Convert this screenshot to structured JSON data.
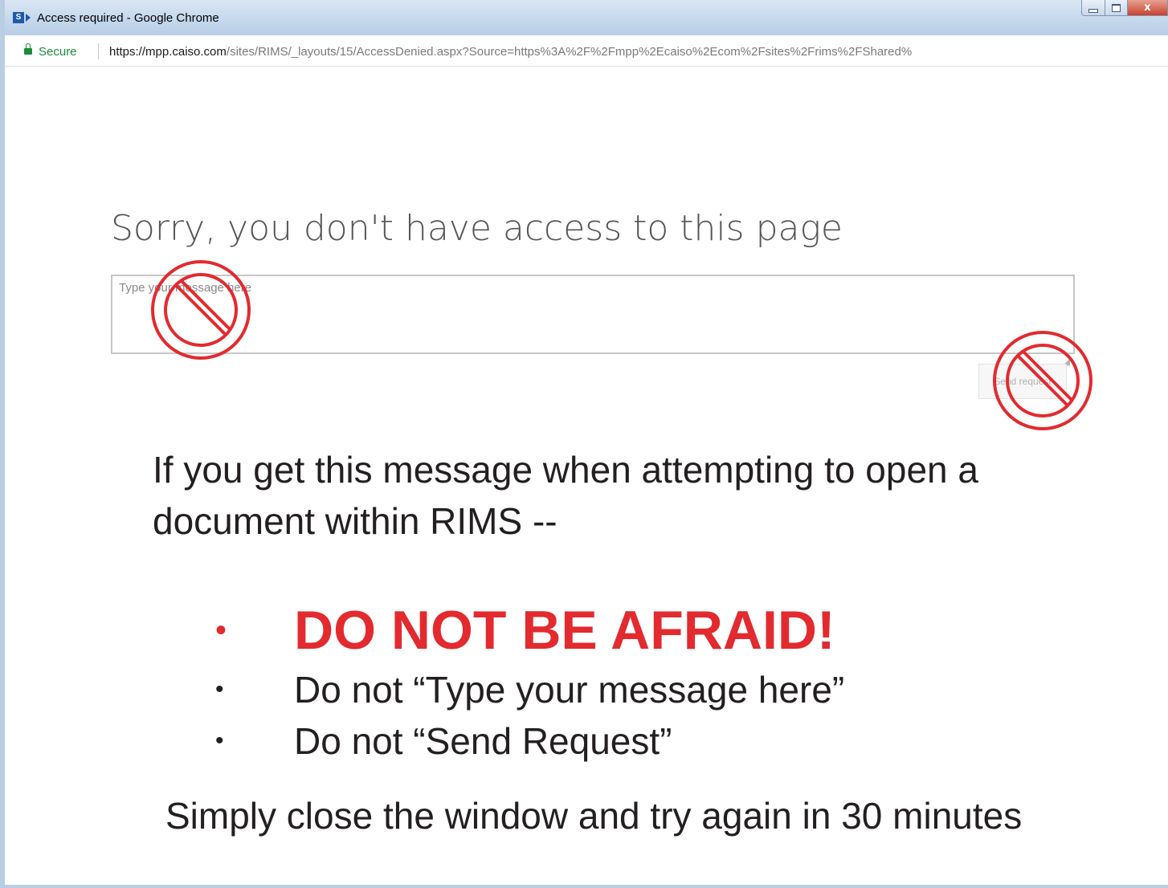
{
  "window": {
    "title": "Access required - Google Chrome",
    "app_icon_letter": "S",
    "controls": {
      "minimize_icon": "minimize-icon",
      "maximize_icon": "maximize-icon",
      "close_icon": "close-icon",
      "close_glyph": "x"
    }
  },
  "address_bar": {
    "secure_label": "Secure",
    "url_host": "https://mpp.caiso.com",
    "url_path": "/sites/RIMS/_layouts/15/AccessDenied.aspx?Source=https%3A%2F%2Fmpp%2Ecaiso%2Ecom%2Fsites%2Frims%2FShared%"
  },
  "page": {
    "heading": "Sorry, you don't have access to this page",
    "message_placeholder": "Type your message here",
    "send_button_label": "Send request",
    "no_sign_color": "#e32a2f"
  },
  "instructions": {
    "intro": "If you get this message when attempting to open a document within RIMS --",
    "bullet_char": "•",
    "bullets": [
      "DO NOT BE AFRAID!",
      "Do not “Type your message here”",
      "Do not “Send Request”"
    ],
    "closing": "Simply close the window and try again in 30 minutes"
  },
  "colors": {
    "alert_red": "#e32a2f",
    "secure_green": "#1b8a3a",
    "body_text": "#231f20"
  }
}
